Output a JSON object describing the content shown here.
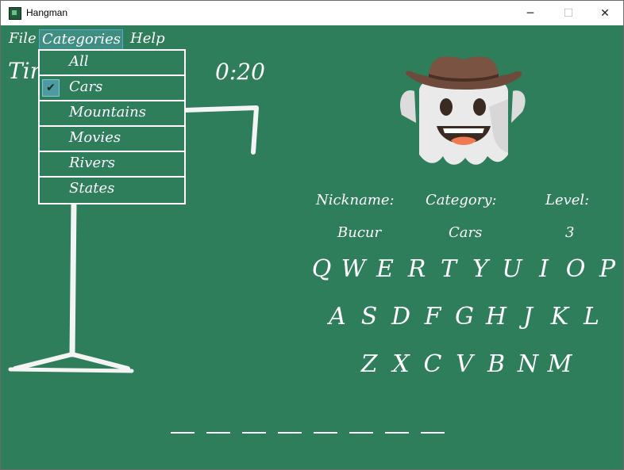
{
  "window": {
    "title": "Hangman",
    "minimize_glyph": "─",
    "maximize_glyph": "☐",
    "close_glyph": "✕"
  },
  "menu": {
    "file": "File",
    "categories": "Categories",
    "help": "Help"
  },
  "categories_dropdown": {
    "items": [
      "All",
      "Cars",
      "Mountains",
      "Movies",
      "Rivers",
      "States"
    ],
    "selected": "Cars",
    "check_glyph": "✔"
  },
  "timer": {
    "label": "Tin",
    "value": "0:20"
  },
  "info": {
    "nickname_label": "Nickname:",
    "category_label": "Category:",
    "level_label": "Level:",
    "nickname": "Bucur",
    "category": "Cars",
    "level": "3"
  },
  "keyboard": {
    "row1": [
      "Q",
      "W",
      "E",
      "R",
      "T",
      "Y",
      "U",
      "I",
      "O",
      "P"
    ],
    "row2": [
      "A",
      "S",
      "D",
      "F",
      "G",
      "H",
      "J",
      "K",
      "L"
    ],
    "row3": [
      "Z",
      "X",
      "C",
      "V",
      "B",
      "N",
      "M"
    ]
  },
  "word": {
    "letters_count": 8
  },
  "colors": {
    "background": "#2e7d5b",
    "chalk": "#ffffff",
    "menu_highlight": "#3e8e83"
  },
  "icons": {
    "ghost": "ghost-cowboy-icon",
    "app": "hangman-app-icon"
  }
}
